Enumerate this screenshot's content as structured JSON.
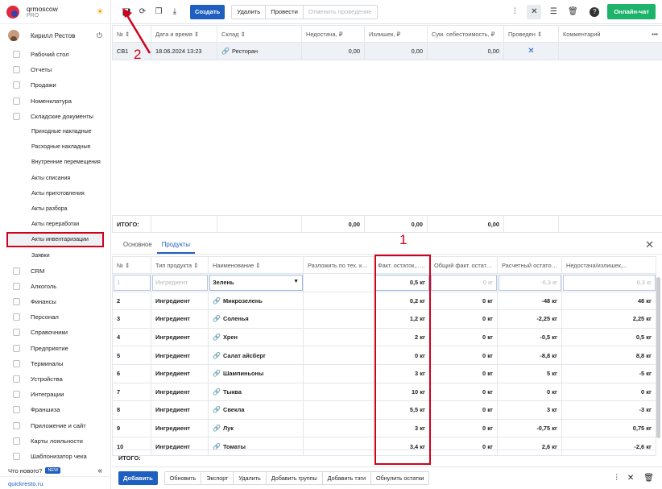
{
  "brand": {
    "name": "qrmoscow",
    "plan": "PRO"
  },
  "user": {
    "name": "Кирилл Рестов"
  },
  "sidebar": {
    "items": [
      {
        "label": "Рабочий стол",
        "icon": "dashboard-icon"
      },
      {
        "label": "Отчеты",
        "icon": "reports-icon"
      },
      {
        "label": "Продажи",
        "icon": "cart-icon"
      },
      {
        "label": "Номенклатура",
        "icon": "tag-icon"
      },
      {
        "label": "Складские документы",
        "icon": "warehouse-icon"
      }
    ],
    "sub_items": [
      {
        "label": "Приходные накладные"
      },
      {
        "label": "Расходные накладные"
      },
      {
        "label": "Внутренние перемещения"
      },
      {
        "label": "Акты списания"
      },
      {
        "label": "Акты приготовления"
      },
      {
        "label": "Акты разбора"
      },
      {
        "label": "Акты переработки"
      },
      {
        "label": "Акты инвентаризации",
        "active": true
      },
      {
        "label": "Заявки"
      }
    ],
    "items_after": [
      {
        "label": "CRM"
      },
      {
        "label": "Алкоголь"
      },
      {
        "label": "Финансы"
      },
      {
        "label": "Персонал"
      },
      {
        "label": "Справочники"
      },
      {
        "label": "Предприятие"
      },
      {
        "label": "Терминалы"
      },
      {
        "label": "Устройства"
      },
      {
        "label": "Интеграции"
      },
      {
        "label": "Франшиза"
      },
      {
        "label": "Приложение и сайт"
      },
      {
        "label": "Карты лояльности"
      },
      {
        "label": "Шаблонизатор чека"
      }
    ],
    "whats_new": "Что нового?",
    "new_badge": "NEW",
    "site": "quickresto.ru"
  },
  "toolbar": {
    "create": "Создать",
    "delete": "Удалить",
    "post": "Провести",
    "unpost": "Отменить проведение",
    "online_chat": "Онлайн-чат"
  },
  "top_table": {
    "headers": [
      "№ ⇕",
      "Дата и время ⇕",
      "Склад ⇕",
      "Недостача, ₽",
      "Излишек, ₽",
      "Сум. себестоимость, ₽",
      "Проведен ⇕",
      "Комментарий"
    ],
    "row": {
      "num": "СВ1",
      "date": "18.06.2024 13:23",
      "warehouse": "Ресторан",
      "shortage": "0,00",
      "surplus": "0,00",
      "cost": "0,00",
      "posted": "✕",
      "comment": ""
    },
    "totals_label": "ИТОГО:",
    "totals": {
      "shortage": "0,00",
      "surplus": "0,00",
      "cost": "0,00"
    },
    "more": "•••"
  },
  "tabs": [
    "Основное",
    "Продукты"
  ],
  "prod_table": {
    "headers": [
      "№ ⇕",
      "Тип продукта ⇕",
      "Наименование ⇕",
      "Разложить по тех. карте",
      "Факт. остаток,...⇕",
      "Общий факт. остаток...",
      "Расчетный остаток...",
      "Недостача/излишек,..."
    ],
    "first_row": {
      "num": "1",
      "type": "Ингредиент",
      "name": "Зелень",
      "fact": "0,5 кг",
      "total_fact": "0 кг",
      "calc": "-6,3 кг",
      "diff": "6,3 кг"
    },
    "rows": [
      {
        "num": "2",
        "type": "Ингредиент",
        "name": "Микрозелень",
        "fact": "0,2 кг",
        "total_fact": "0 кг",
        "calc": "-48 кг",
        "diff": "48 кг"
      },
      {
        "num": "3",
        "type": "Ингредиент",
        "name": "Соленья",
        "fact": "1,2 кг",
        "total_fact": "0 кг",
        "calc": "-2,25 кг",
        "diff": "2,25 кг"
      },
      {
        "num": "4",
        "type": "Ингредиент",
        "name": "Хрен",
        "fact": "2 кг",
        "total_fact": "0 кг",
        "calc": "-0,5 кг",
        "diff": "0,5 кг"
      },
      {
        "num": "5",
        "type": "Ингредиент",
        "name": "Салат айсберг",
        "fact": "0 кг",
        "total_fact": "0 кг",
        "calc": "-8,8 кг",
        "diff": "8,8 кг"
      },
      {
        "num": "6",
        "type": "Ингредиент",
        "name": "Шампиньоны",
        "fact": "3 кг",
        "total_fact": "0 кг",
        "calc": "5 кг",
        "diff": "-5 кг"
      },
      {
        "num": "7",
        "type": "Ингредиент",
        "name": "Тыква",
        "fact": "10 кг",
        "total_fact": "0 кг",
        "calc": "0 кг",
        "diff": "0 кг"
      },
      {
        "num": "8",
        "type": "Ингредиент",
        "name": "Свекла",
        "fact": "5,5 кг",
        "total_fact": "0 кг",
        "calc": "3 кг",
        "diff": "-3 кг"
      },
      {
        "num": "9",
        "type": "Ингредиент",
        "name": "Лук",
        "fact": "3 кг",
        "total_fact": "0 кг",
        "calc": "-0,75 кг",
        "diff": "0,75 кг"
      },
      {
        "num": "10",
        "type": "Ингредиент",
        "name": "Томаты",
        "fact": "3,4 кг",
        "total_fact": "0 кг",
        "calc": "2,6 кг",
        "diff": "-2,6 кг"
      }
    ],
    "totals_label": "ИТОГО:"
  },
  "bottom": {
    "add": "Добавить",
    "refresh": "Обновить",
    "export": "Экспорт",
    "delete": "Удалить",
    "add_groups": "Добавить группы",
    "add_tags": "Добавить тэги",
    "reset": "Обнулить остатки"
  },
  "annotations": {
    "one": "1",
    "two": "2"
  },
  "colors": {
    "accent": "#1f5fbf",
    "chat": "#1db36b",
    "annotation": "#d0021b"
  }
}
